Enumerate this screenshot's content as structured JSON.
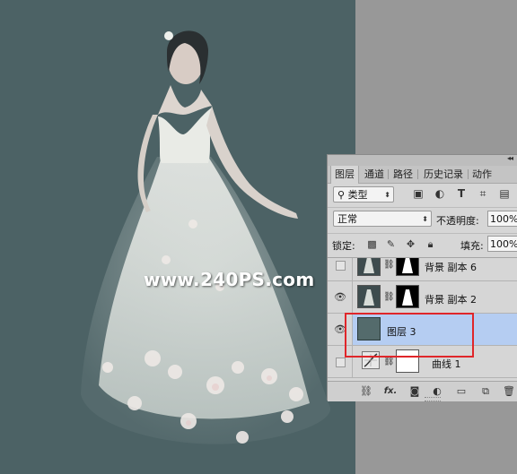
{
  "watermark": "www.240PS.com",
  "panel": {
    "tabs": [
      "图层",
      "通道",
      "路径",
      "历史记录",
      "动作"
    ],
    "active_tab": "图层",
    "filter_kind": "类型",
    "filter_icons": [
      "image-filter-icon",
      "adjustment-filter-icon",
      "type-filter-icon",
      "shape-filter-icon",
      "smart-object-filter-icon"
    ],
    "blend_mode": "正常",
    "opacity_label": "不透明度:",
    "opacity_value": "100%",
    "lock_label": "锁定:",
    "fill_label": "填充:",
    "fill_value": "100%",
    "layers": [
      {
        "name": "背景 副本 6",
        "visible": false,
        "selected": false,
        "masked": true
      },
      {
        "name": "背景 副本 2",
        "visible": true,
        "selected": false,
        "masked": true
      },
      {
        "name": "图层 3",
        "visible": true,
        "selected": true,
        "masked": false
      },
      {
        "name": "曲线 1",
        "visible": false,
        "selected": false,
        "masked": true
      }
    ],
    "footer_icons": [
      "link-layers-icon",
      "fx-icon",
      "add-mask-icon",
      "adjustment-layer-icon",
      "group-folder-icon",
      "new-layer-icon",
      "trash-icon"
    ],
    "fx_label": "fx."
  },
  "colors": {
    "canvas_bg": "#4c6265",
    "selected_row": "#b5cdf2",
    "highlight_box": "#e0262a",
    "layer3_fill": "#546b6c"
  }
}
